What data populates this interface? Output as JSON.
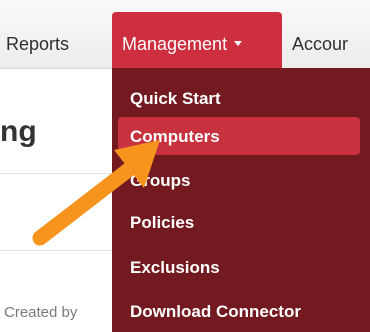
{
  "navbar": {
    "reports_label": "Reports",
    "management_label": "Management",
    "accounts_label": "Accour"
  },
  "page": {
    "heading_fragment": "ng",
    "footer_text": "Created by"
  },
  "dropdown": {
    "items": [
      {
        "label": "Quick Start"
      },
      {
        "label": "Computers",
        "active": true
      },
      {
        "label": "Groups"
      },
      {
        "label": "Policies"
      },
      {
        "label": "Exclusions"
      },
      {
        "label": "Download Connector"
      }
    ]
  },
  "annotation": {
    "arrow_icon": "orange-pointer-arrow-icon",
    "arrow_color": "#f7941d"
  },
  "colors": {
    "accent": "#ce2f3f",
    "dropdown_bg": "#731a21",
    "active_item_bg": "#c8323f"
  }
}
